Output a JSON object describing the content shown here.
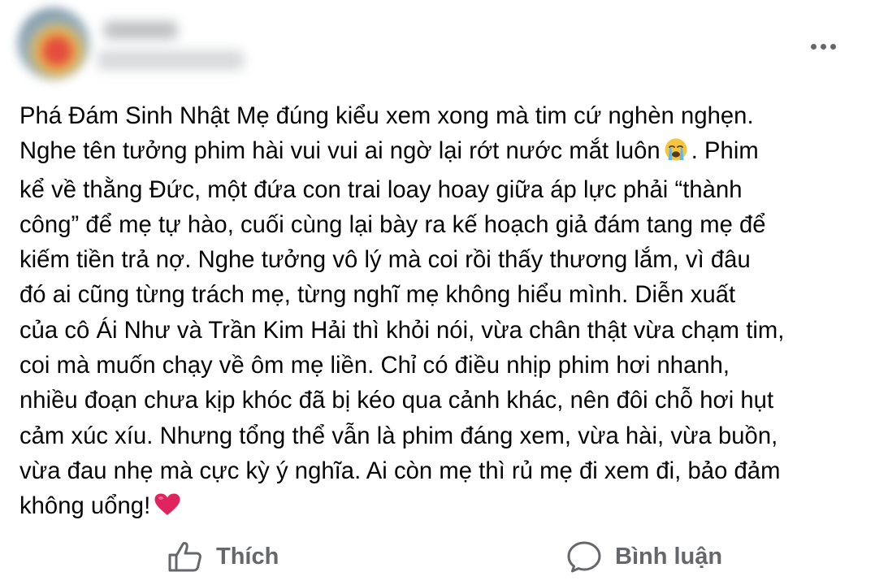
{
  "post": {
    "text_lines": [
      "Phá Đám Sinh Nhật Mẹ đúng kiểu xem xong mà tim cứ nghèn nghẹn.",
      "Nghe tên tưởng phim hài vui vui ai ngờ lại rớt nước mắt luôn",
      ". Phim",
      "kể về thằng Đức, một đứa con trai loay hoay giữa áp lực phải “thành",
      "công” để mẹ tự hào, cuối cùng lại bày ra kế hoạch giả đám tang mẹ để",
      "kiếm tiền trả nợ. Nghe tưởng vô lý mà coi rồi thấy thương lắm, vì đâu",
      "đó ai cũng từng trách mẹ, từng nghĩ mẹ không hiểu mình. Diễn xuất",
      "của cô Ái Như và Trần Kim Hải thì khỏi nói, vừa chân thật vừa chạm tim,",
      "coi mà muốn chạy về ôm mẹ liền. Chỉ có điều nhịp phim hơi nhanh,",
      "nhiều đoạn chưa kịp khóc đã bị kéo qua cảnh khác, nên đôi chỗ hơi hụt",
      "cảm xúc xíu. Nhưng tổng thể vẫn là phim đáng xem, vừa hài, vừa buồn,",
      "vừa đau nhẹ mà cực kỳ ý nghĩa. Ai còn mẹ thì rủ mẹ đi xem đi, bảo đảm",
      "không uổng!"
    ],
    "emoji_cry": "crying-face-emoji",
    "emoji_heart": "red-heart-emoji"
  },
  "actions": {
    "like_label": "Thích",
    "comment_label": "Bình luận"
  },
  "colors": {
    "text": "#050505",
    "secondary": "#65676b",
    "heart": "#e0245e",
    "emoji_face": "#f6c53d"
  }
}
